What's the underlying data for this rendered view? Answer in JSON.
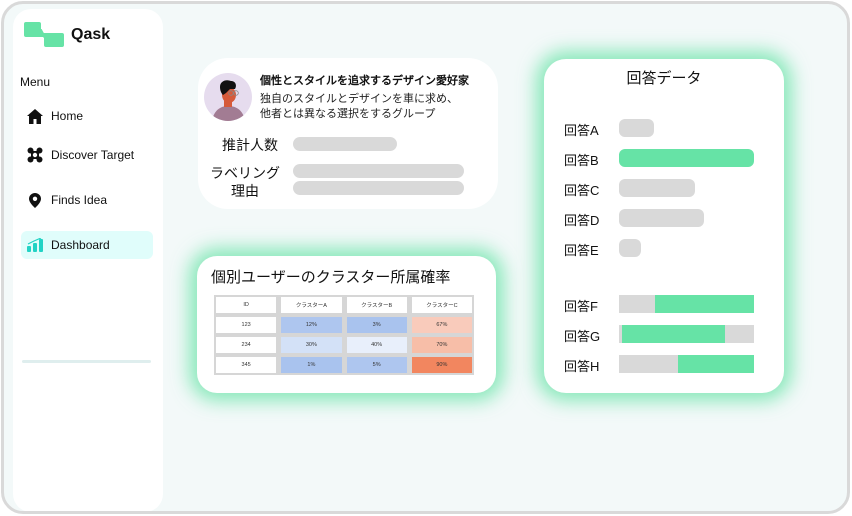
{
  "app": {
    "name": "Qask"
  },
  "sidebar": {
    "menu_label": "Menu",
    "items": [
      {
        "label": "Home",
        "icon": "home-icon",
        "active": false
      },
      {
        "label": "Discover Target",
        "icon": "target-icon",
        "active": false
      },
      {
        "label": "Finds Idea",
        "icon": "location-pin-icon",
        "active": false
      },
      {
        "label": "Dashboard",
        "icon": "bar-chart-icon",
        "active": true
      }
    ]
  },
  "persona": {
    "title": "個性とスタイルを追求するデザイン愛好家",
    "description_line1": "独自のスタイルとデザインを車に求め、",
    "description_line2": "他者とは異なる選択をするグループ",
    "estimated_count_label": "推計人数",
    "labeling_reason_label_line1": "ラベリング",
    "labeling_reason_label_line2": "理由"
  },
  "cluster_table": {
    "title": "個別ユーザーのクラスター所属確率",
    "headers": [
      "ID",
      "クラスターA",
      "クラスターB",
      "クラスターC"
    ],
    "rows": [
      {
        "id": "123",
        "a": "12%",
        "b": "3%",
        "c": "67%"
      },
      {
        "id": "234",
        "a": "30%",
        "b": "40%",
        "c": "70%"
      },
      {
        "id": "345",
        "a": "1%",
        "b": "5%",
        "c": "90%"
      }
    ],
    "colors": {
      "row1": [
        "#ffffff",
        "#aec6ef",
        "#a9c3ee",
        "#f9cbbb"
      ],
      "row2": [
        "#ffffff",
        "#d3e1f7",
        "#e8effb",
        "#f7bea8"
      ],
      "row3": [
        "#ffffff",
        "#a9c3ee",
        "#aec6ef",
        "#f2865f"
      ]
    }
  },
  "answers": {
    "title": "回答データ",
    "single": [
      {
        "label": "回答A",
        "value": 0.26,
        "highlight": false
      },
      {
        "label": "回答B",
        "value": 1.0,
        "highlight": true
      },
      {
        "label": "回答C",
        "value": 0.56,
        "highlight": false
      },
      {
        "label": "回答D",
        "value": 0.63,
        "highlight": false
      },
      {
        "label": "回答E",
        "value": 0.16,
        "highlight": false
      }
    ],
    "stacked": [
      {
        "label": "回答F",
        "gray": 0.27,
        "green": 0.73,
        "green_first": false
      },
      {
        "label": "回答G",
        "gray": 0.22,
        "green": 0.76,
        "green_first": true
      },
      {
        "label": "回答H",
        "gray": 0.44,
        "green": 0.56,
        "green_first": false
      }
    ]
  },
  "colors": {
    "accent_green": "#66e3a6",
    "active_nav_bg": "#e0fdfb",
    "bar_gray": "#d9d9d9"
  }
}
